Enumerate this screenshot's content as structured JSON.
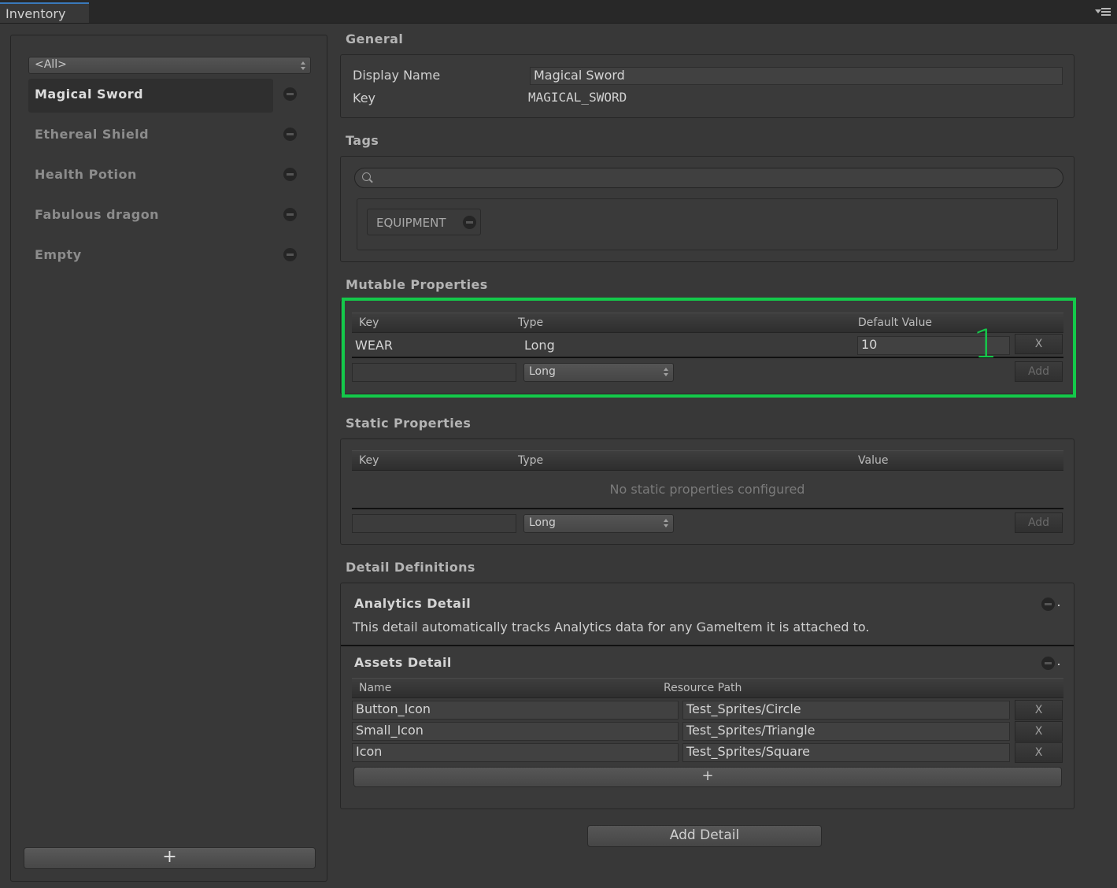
{
  "window": {
    "tab_title": "Inventory",
    "menu_icon": "window-menu-icon"
  },
  "sidebar": {
    "filter_value": "<All>",
    "items": [
      {
        "label": "Magical Sword",
        "selected": true
      },
      {
        "label": "Ethereal Shield",
        "selected": false
      },
      {
        "label": "Health Potion",
        "selected": false
      },
      {
        "label": "Fabulous dragon",
        "selected": false
      },
      {
        "label": "Empty",
        "selected": false
      }
    ],
    "add_button_label": "+"
  },
  "general": {
    "title": "General",
    "display_name_label": "Display Name",
    "display_name_value": "Magical Sword",
    "key_label": "Key",
    "key_value": "MAGICAL_SWORD"
  },
  "tags": {
    "title": "Tags",
    "search_placeholder": "",
    "chips": [
      {
        "label": "EQUIPMENT"
      }
    ]
  },
  "mutable": {
    "title": "Mutable Properties",
    "columns": {
      "key": "Key",
      "type": "Type",
      "default": "Default Value"
    },
    "rows": [
      {
        "key": "WEAR",
        "type": "Long",
        "default_value": "10",
        "remove_label": "X"
      }
    ],
    "new_type": "Long",
    "add_label": "Add",
    "annotation": "1",
    "highlight_color": "#14c94a"
  },
  "static": {
    "title": "Static Properties",
    "columns": {
      "key": "Key",
      "type": "Type",
      "value": "Value"
    },
    "empty_message": "No static properties configured",
    "new_type": "Long",
    "add_label": "Add"
  },
  "details": {
    "title": "Detail Definitions",
    "analytics": {
      "title": "Analytics Detail",
      "description": "This detail automatically tracks Analytics data for any GameItem it is attached to."
    },
    "assets": {
      "title": "Assets Detail",
      "columns": {
        "name": "Name",
        "path": "Resource Path"
      },
      "rows": [
        {
          "name": "Button_Icon",
          "path": "Test_Sprites/Circle",
          "remove_label": "X"
        },
        {
          "name": "Small_Icon",
          "path": "Test_Sprites/Triangle",
          "remove_label": "X"
        },
        {
          "name": "Icon",
          "path": "Test_Sprites/Square",
          "remove_label": "X"
        }
      ],
      "add_row_label": "+"
    },
    "add_detail_label": "Add Detail"
  }
}
